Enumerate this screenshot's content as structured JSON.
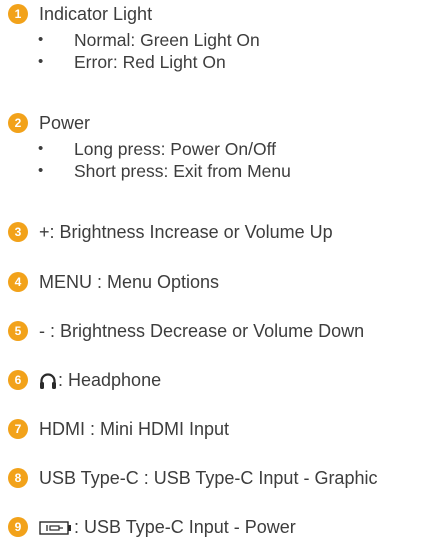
{
  "items": [
    {
      "number": "1",
      "badge_color": "#f2a21a",
      "label": "Indicator Light",
      "subitems": [
        "Normal: Green Light On",
        "Error: Red Light On"
      ]
    },
    {
      "number": "2",
      "badge_color": "#f2a21a",
      "label": "Power",
      "subitems": [
        "Long press: Power On/Off",
        "Short press: Exit from Menu"
      ]
    },
    {
      "number": "3",
      "badge_color": "#f2a21a",
      "label": "+: Brightness Increase or Volume Up"
    },
    {
      "number": "4",
      "badge_color": "#f2a21a",
      "label": "MENU : Menu Options"
    },
    {
      "number": "5",
      "badge_color": "#f2a21a",
      "label": "- : Brightness Decrease or Volume Down"
    },
    {
      "number": "6",
      "badge_color": "#f2a21a",
      "icon": "headphone-icon",
      "label": ": Headphone"
    },
    {
      "number": "7",
      "badge_color": "#f2a21a",
      "label": "HDMI : Mini HDMI Input"
    },
    {
      "number": "8",
      "badge_color": "#f2a21a",
      "label": "USB Type-C : USB Type-C Input - Graphic"
    },
    {
      "number": "9",
      "badge_color": "#f2a21a",
      "icon": "usb-power-icon",
      "label": ": USB Type-C Input - Power"
    }
  ]
}
